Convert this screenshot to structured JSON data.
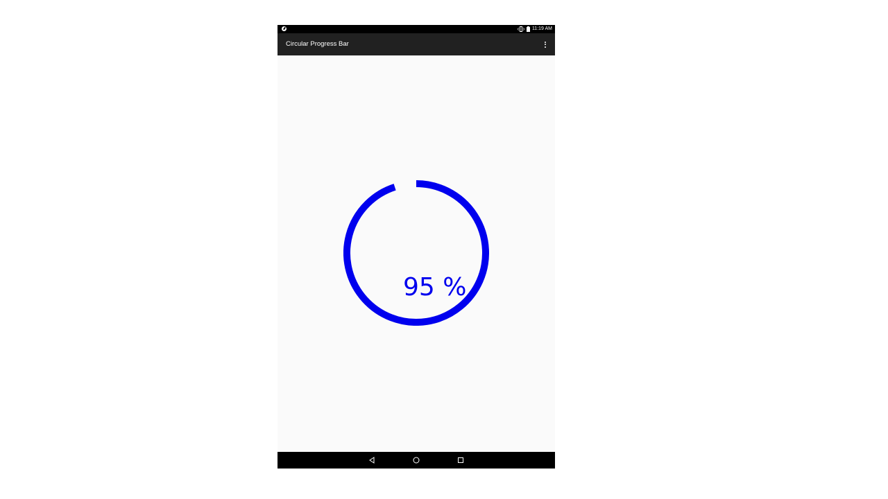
{
  "status_bar": {
    "time": "11:19 AM",
    "left_icon": "app-notification-icon",
    "icons": [
      "vibrate-icon",
      "battery-icon"
    ]
  },
  "app_bar": {
    "title": "Circular Progress Bar",
    "menu_icon": "overflow-menu-icon"
  },
  "progress": {
    "value": 95,
    "label": "95 %",
    "color": "#0000ee"
  },
  "nav_bar": {
    "buttons": [
      "back-icon",
      "home-icon",
      "recents-icon"
    ]
  },
  "colors": {
    "status_bar": "#000000",
    "app_bar": "#212121",
    "content_bg": "#fafafa",
    "accent": "#0000ee"
  }
}
